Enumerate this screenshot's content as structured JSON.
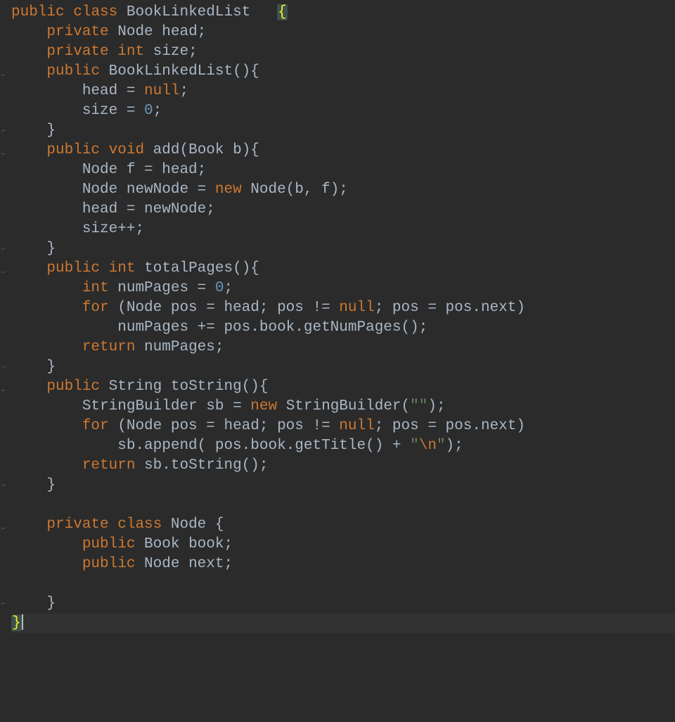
{
  "language": "Java",
  "class_name": "BookLinkedList",
  "tokens": {
    "kw_public": "public",
    "kw_class": "class",
    "kw_private": "private",
    "kw_void": "void",
    "kw_int": "int",
    "kw_new": "new",
    "kw_for": "for",
    "kw_return": "return",
    "kw_null": "null"
  },
  "fields": {
    "head_decl": "Node head;",
    "size_decl": "size;"
  },
  "ctor": {
    "sig_open": "BookLinkedList(){",
    "body1_lhs": "head = ",
    "body1_rhs_end": ";",
    "body2_lhs": "size = ",
    "body2_num": "0",
    "body2_end": ";",
    "close": "}"
  },
  "add": {
    "sig": " add(Book b){",
    "l1": "Node f = head;",
    "l2a": "Node newNode = ",
    "l2b": " Node(b, f);",
    "l3": "head = newNode;",
    "l4": "size++;",
    "close": "}"
  },
  "totalPages": {
    "sig": " totalPages(){",
    "l1a": " numPages = ",
    "l1num": "0",
    "l1end": ";",
    "for_a": " (Node pos = head; pos != ",
    "for_b": "; pos = pos.next)",
    "body": "numPages += pos.book.getNumPages();",
    "ret": " numPages;",
    "close": "}"
  },
  "toString": {
    "sig": " String toString(){",
    "l1a": "StringBuilder sb = ",
    "l1b": " StringBuilder(",
    "l1str": "\"\"",
    "l1end": ");",
    "for_a": " (Node pos = head; pos != ",
    "for_b": "; pos = pos.next)",
    "body_a": "sb.append( pos.book.getTitle() + ",
    "body_str_open": "\"",
    "body_str_esc": "\\n",
    "body_str_close": "\"",
    "body_end": ");",
    "ret": " sb.toString();",
    "close": "}"
  },
  "node": {
    "sig": " Node {",
    "f1": " Book book;",
    "f2": " Node next;",
    "close": "}"
  },
  "class_close": "}",
  "open_brace": "{",
  "gutter_icons": [
    "",
    "",
    "",
    "▢",
    "",
    "",
    "⌐",
    "▢",
    "",
    "",
    "",
    "",
    "⌐",
    "▢",
    "",
    "",
    "",
    "",
    "⌐",
    "▢",
    "",
    "",
    "",
    "",
    "⌐",
    "",
    "▢",
    "",
    "",
    "",
    "⌐",
    ""
  ]
}
